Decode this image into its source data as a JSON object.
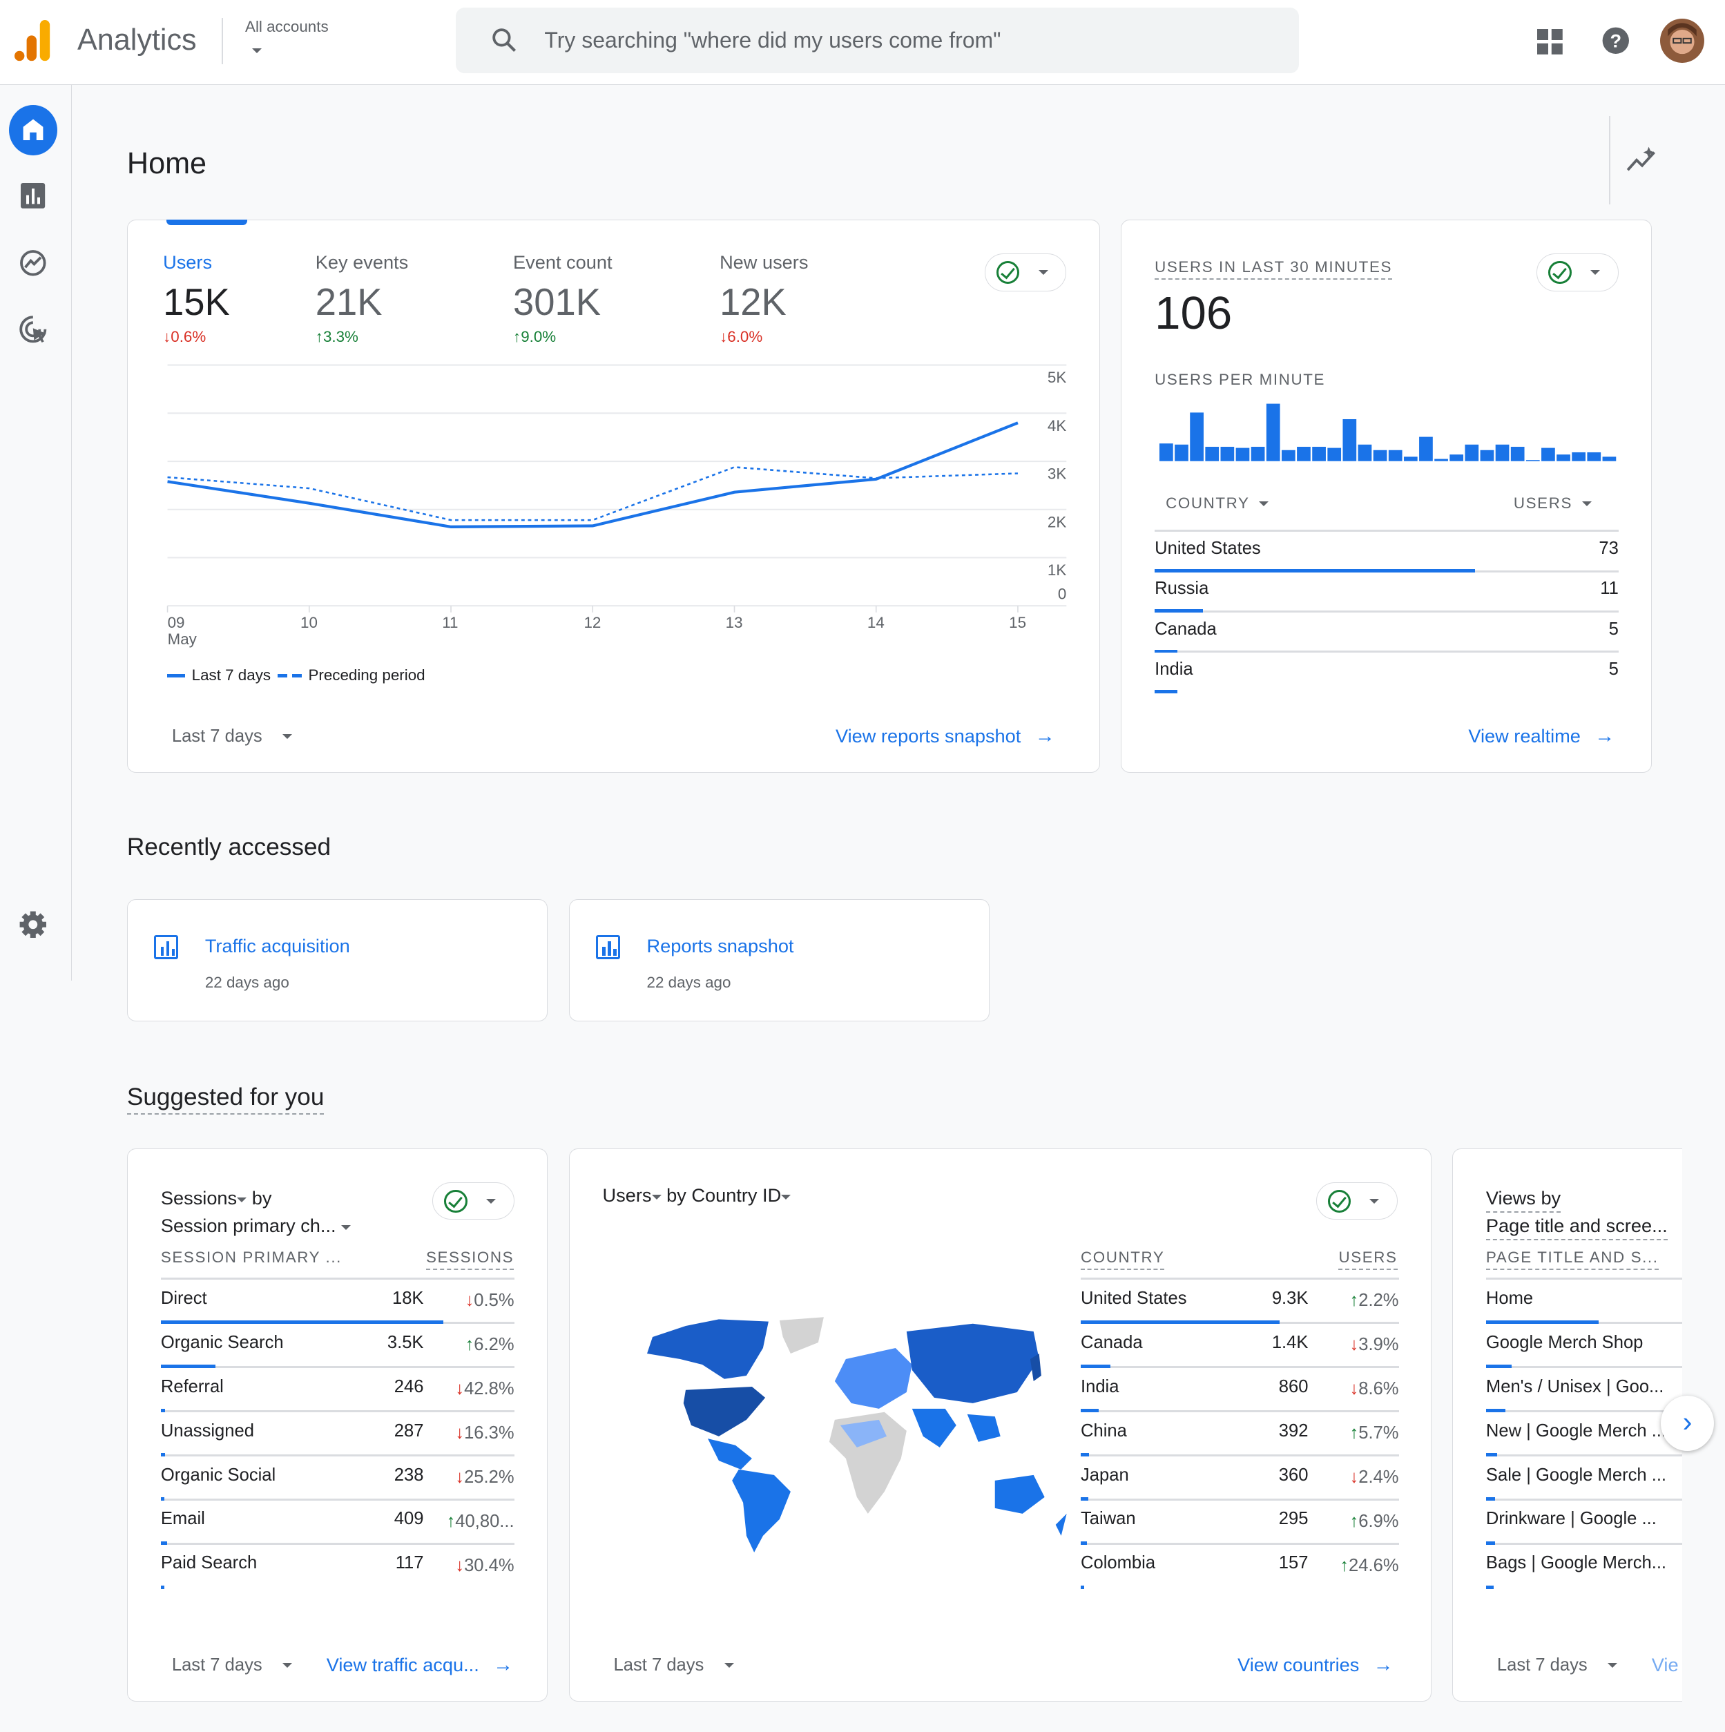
{
  "header": {
    "app_name": "Analytics",
    "account_label": "All accounts",
    "search_placeholder": "Try searching \"where did my users come from\"",
    "icons": [
      "apps-grid-icon",
      "help-icon",
      "avatar"
    ]
  },
  "nav": {
    "items": [
      {
        "name": "home",
        "icon": "home-icon",
        "active": true
      },
      {
        "name": "reports",
        "icon": "bar-chart-icon"
      },
      {
        "name": "explore",
        "icon": "explore-icon"
      },
      {
        "name": "advertising",
        "icon": "target-cursor-icon"
      }
    ],
    "settings_icon": "gear-icon"
  },
  "page": {
    "title": "Home",
    "insights_icon": "insights-sparkle-icon"
  },
  "overview": {
    "metrics": [
      {
        "label": "Users",
        "value": "15K",
        "change": "0.6%",
        "direction": "down",
        "active": true
      },
      {
        "label": "Key events",
        "value": "21K",
        "change": "3.3%",
        "direction": "up"
      },
      {
        "label": "Event count",
        "value": "301K",
        "change": "9.0%",
        "direction": "up"
      },
      {
        "label": "New users",
        "value": "12K",
        "change": "6.0%",
        "direction": "down"
      }
    ],
    "date_range": "Last 7 days",
    "link": "View reports snapshot"
  },
  "chart_data": [
    {
      "type": "line",
      "x": [
        "09",
        "10",
        "11",
        "12",
        "13",
        "14",
        "15"
      ],
      "x_sublabel": "May",
      "yticks": [
        "0",
        "1K",
        "2K",
        "3K",
        "4K",
        "5K"
      ],
      "ylim": [
        0,
        5000
      ],
      "grid": true,
      "legend_placement": "bottom-left",
      "series": [
        {
          "name": "Last 7 days",
          "style": "solid",
          "color": "#1a73e8",
          "values": [
            2580,
            2130,
            1640,
            1660,
            2360,
            2630,
            3800
          ]
        },
        {
          "name": "Preceding period",
          "style": "dashed",
          "color": "#1a73e8",
          "values": [
            2670,
            2440,
            1780,
            1780,
            2880,
            2650,
            2750
          ]
        }
      ]
    },
    {
      "type": "bar",
      "title": "USERS PER MINUTE",
      "color": "#1a73e8",
      "values": [
        8,
        7.5,
        22,
        6.5,
        6.5,
        6,
        6.5,
        26,
        5,
        6.5,
        6.5,
        6,
        19,
        7.5,
        5,
        5,
        2,
        11,
        1,
        3,
        7.5,
        5,
        7.5,
        6.5,
        0.3,
        6,
        3,
        4,
        4,
        2
      ]
    }
  ],
  "realtime": {
    "title": "USERS IN LAST 30 MINUTES",
    "value": "106",
    "subtitle": "USERS PER MINUTE",
    "col_country": "COUNTRY",
    "col_users": "USERS",
    "rows": [
      {
        "country": "United States",
        "users": "73",
        "share": 1
      },
      {
        "country": "Russia",
        "users": "11",
        "share": 0.151
      },
      {
        "country": "Canada",
        "users": "5",
        "share": 0.07
      },
      {
        "country": "India",
        "users": "5",
        "share": 0.07
      }
    ],
    "link": "View realtime"
  },
  "recent": {
    "title": "Recently accessed",
    "items": [
      {
        "title": "Traffic acquisition",
        "time": "22 days ago"
      },
      {
        "title": "Reports snapshot",
        "time": "22 days ago"
      }
    ]
  },
  "suggested": {
    "title": "Suggested for you",
    "sessions": {
      "metric": "Sessions",
      "by": "by",
      "dimension": "Session primary ch...",
      "col1": "SESSION PRIMARY ...",
      "col2": "SESSIONS",
      "rows": [
        {
          "name": "Direct",
          "value": "18K",
          "change": "0.5%",
          "direction": "down",
          "share": 1
        },
        {
          "name": "Organic Search",
          "value": "3.5K",
          "change": "6.2%",
          "direction": "up",
          "share": 0.194
        },
        {
          "name": "Referral",
          "value": "246",
          "change": "42.8%",
          "direction": "down",
          "share": 0.014
        },
        {
          "name": "Unassigned",
          "value": "287",
          "change": "16.3%",
          "direction": "down",
          "share": 0.016
        },
        {
          "name": "Organic Social",
          "value": "238",
          "change": "25.2%",
          "direction": "down",
          "share": 0.013
        },
        {
          "name": "Email",
          "value": "409",
          "change": "40,80...",
          "direction": "up",
          "share": 0.023
        },
        {
          "name": "Paid Search",
          "value": "117",
          "change": "30.4%",
          "direction": "down",
          "share": 0.006
        }
      ],
      "date_range": "Last 7 days",
      "link": "View traffic acqu..."
    },
    "countries": {
      "metric": "Users",
      "by": "by",
      "dimension": "Country ID",
      "col1": "COUNTRY",
      "col2": "USERS",
      "rows": [
        {
          "name": "United States",
          "value": "9.3K",
          "change": "2.2%",
          "direction": "up",
          "share": 1
        },
        {
          "name": "Canada",
          "value": "1.4K",
          "change": "3.9%",
          "direction": "down",
          "share": 0.15
        },
        {
          "name": "India",
          "value": "860",
          "change": "8.6%",
          "direction": "down",
          "share": 0.092
        },
        {
          "name": "China",
          "value": "392",
          "change": "5.7%",
          "direction": "up",
          "share": 0.042
        },
        {
          "name": "Japan",
          "value": "360",
          "change": "2.4%",
          "direction": "down",
          "share": 0.039
        },
        {
          "name": "Taiwan",
          "value": "295",
          "change": "6.9%",
          "direction": "up",
          "share": 0.032
        },
        {
          "name": "Colombia",
          "value": "157",
          "change": "24.6%",
          "direction": "up",
          "share": 0.017
        }
      ],
      "date_range": "Last 7 days",
      "link": "View countries"
    },
    "pages": {
      "title_line1": "Views by",
      "title_line2": "Page title and scree...",
      "col1": "PAGE TITLE AND S...",
      "rows": [
        {
          "name": "Home",
          "share": 1
        },
        {
          "name": "Google Merch Shop",
          "share": 0.23
        },
        {
          "name": "Men's / Unisex | Goo...",
          "share": 0.17
        },
        {
          "name": "New | Google Merch ...",
          "share": 0.1
        },
        {
          "name": "Sale | Google Merch ...",
          "share": 0.08
        },
        {
          "name": "Drinkware | Google ...",
          "share": 0.08
        },
        {
          "name": "Bags | Google Merch...",
          "share": 0.07
        }
      ],
      "date_range": "Last 7 days",
      "link": "Vie"
    }
  }
}
